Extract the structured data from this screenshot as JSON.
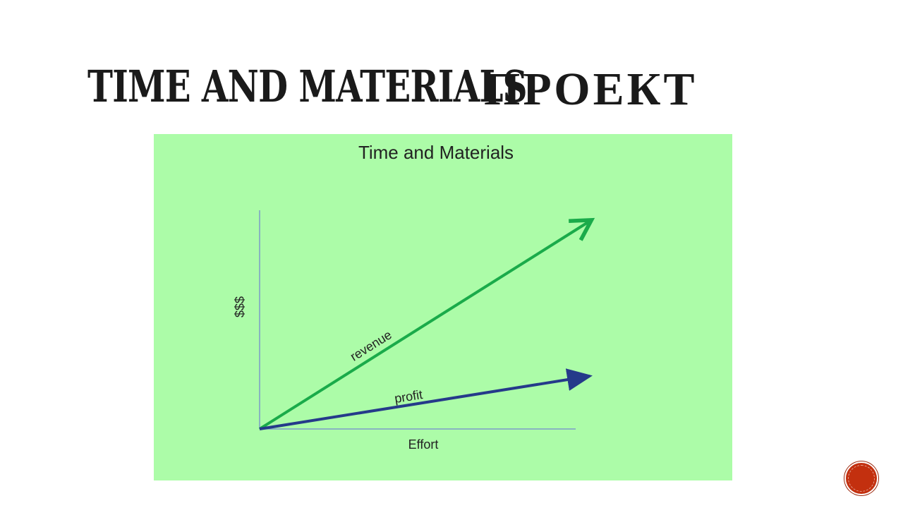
{
  "slide": {
    "title_bold": "TIME AND MATERIALS",
    "title_light": "ПРОЕКТ"
  },
  "diagram": {
    "title": "Time and Materials",
    "y_axis_label": "$$$",
    "x_axis_label": "Effort",
    "arrows": [
      {
        "label": "revenue",
        "color": "#1aab4a"
      },
      {
        "label": "profit",
        "color": "#253a8a"
      }
    ],
    "panel_color": "#acfca8",
    "axis_color": "#7d9bc8"
  },
  "nav": {
    "button_color": "#c3300f"
  }
}
